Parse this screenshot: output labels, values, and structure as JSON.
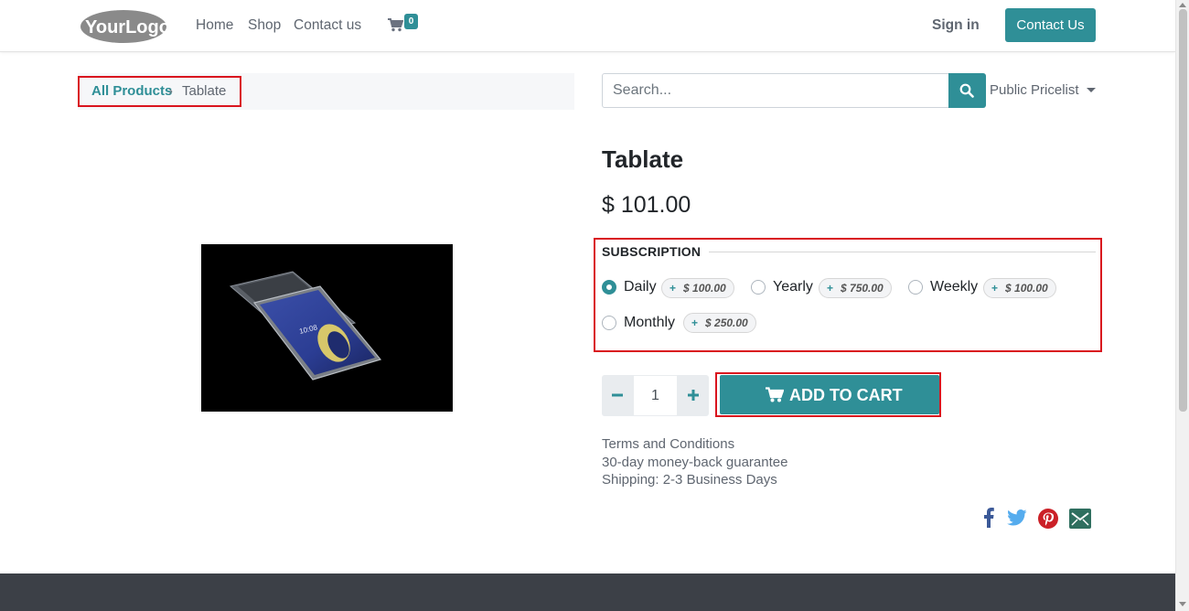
{
  "header": {
    "logo_text": "YourLogo",
    "nav": [
      "Home",
      "Shop",
      "Contact us"
    ],
    "cart_count": "0",
    "signin": "Sign in",
    "contact_button": "Contact Us"
  },
  "breadcrumb": {
    "parent": "All Products",
    "separator": "›",
    "current": "Tablate"
  },
  "search": {
    "placeholder": "Search...",
    "pricelist": "Public Pricelist"
  },
  "product": {
    "title": "Tablate",
    "price": "$ 101.00",
    "subscription_heading": "SUBSCRIPTION",
    "options": [
      {
        "label": "Daily",
        "price": "$ 100.00",
        "selected": true
      },
      {
        "label": "Yearly",
        "price": "$ 750.00",
        "selected": false
      },
      {
        "label": "Weekly",
        "price": "$ 100.00",
        "selected": false
      },
      {
        "label": "Monthly",
        "price": "$ 250.00",
        "selected": false
      }
    ],
    "quantity": "1",
    "add_to_cart": "ADD TO CART",
    "info": [
      "Terms and Conditions",
      "30-day money-back guarantee",
      "Shipping: 2-3 Business Days"
    ],
    "tablet_screen_time": "10:08"
  },
  "colors": {
    "accent": "#2f8f97",
    "highlight": "#d9141e",
    "facebook": "#3b5998",
    "twitter": "#55acee",
    "pinterest": "#cb2027",
    "email": "#2f6f5f"
  },
  "social_icons": [
    "facebook-icon",
    "twitter-icon",
    "pinterest-icon",
    "email-icon"
  ]
}
